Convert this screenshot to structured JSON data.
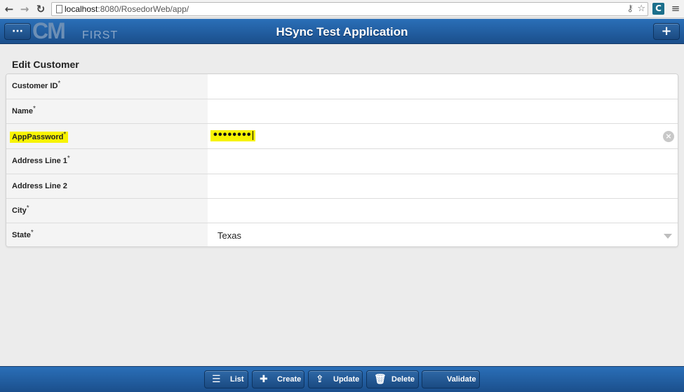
{
  "browser": {
    "back_icon": "back-arrow-icon",
    "forward_icon": "forward-arrow-icon",
    "reload_icon": "reload-icon",
    "url_host": "localhost",
    "url_path": ":8080/RosedorWeb/app/"
  },
  "header": {
    "title": "HSync Test Application",
    "menu_button_label": "···",
    "add_button_label": "+",
    "logo_text": "CM",
    "logo_sub": "FIRST"
  },
  "form": {
    "title": "Edit Customer",
    "required_marker": "*",
    "fields": [
      {
        "label": "Customer ID",
        "required": true,
        "value": ""
      },
      {
        "label": "Name",
        "required": true,
        "value": ""
      },
      {
        "label": "AppPassword",
        "required": true,
        "value": "••••••••",
        "highlighted": true
      },
      {
        "label": "Address Line 1",
        "required": true,
        "value": ""
      },
      {
        "label": "Address Line 2",
        "required": false,
        "value": ""
      },
      {
        "label": "City",
        "required": true,
        "value": ""
      },
      {
        "label": "State",
        "required": true,
        "value": "Texas"
      }
    ]
  },
  "toolbar": {
    "list_label": "List",
    "create_label": "Create",
    "update_label": "Update",
    "delete_label": "Delete",
    "validate_label": "Validate"
  },
  "colors": {
    "header_bg": "#2a6fb8",
    "highlight": "#f7f300"
  }
}
